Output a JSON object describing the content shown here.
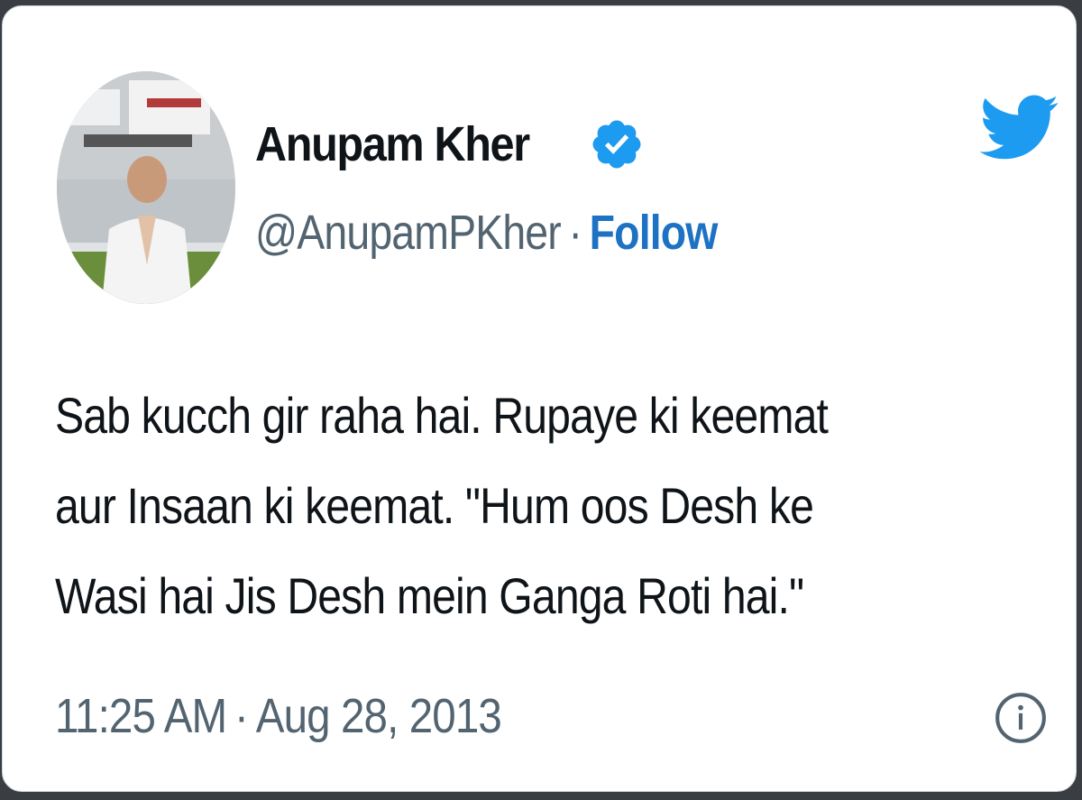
{
  "author": {
    "display_name": "Anupam Kher",
    "verified": true,
    "handle": "@AnupamPKher",
    "separator": "·",
    "follow_label": "Follow",
    "avatar_icon": "profile-photo"
  },
  "tweet": {
    "lines": [
      "Sab kucch gir raha hai. Rupaye ki keemat",
      "aur Insaan ki keemat. \"Hum oos Desh ke",
      "Wasi hai Jis Desh mein Ganga Roti hai.\""
    ]
  },
  "meta": {
    "time": "11:25 AM",
    "separator": "·",
    "date": "Aug 28, 2013",
    "info_icon": "info-icon"
  },
  "colors": {
    "twitter_blue": "#1d9bf0",
    "follow_blue": "#1d72c4",
    "text": "#0f1419",
    "secondary_text": "#536471"
  }
}
